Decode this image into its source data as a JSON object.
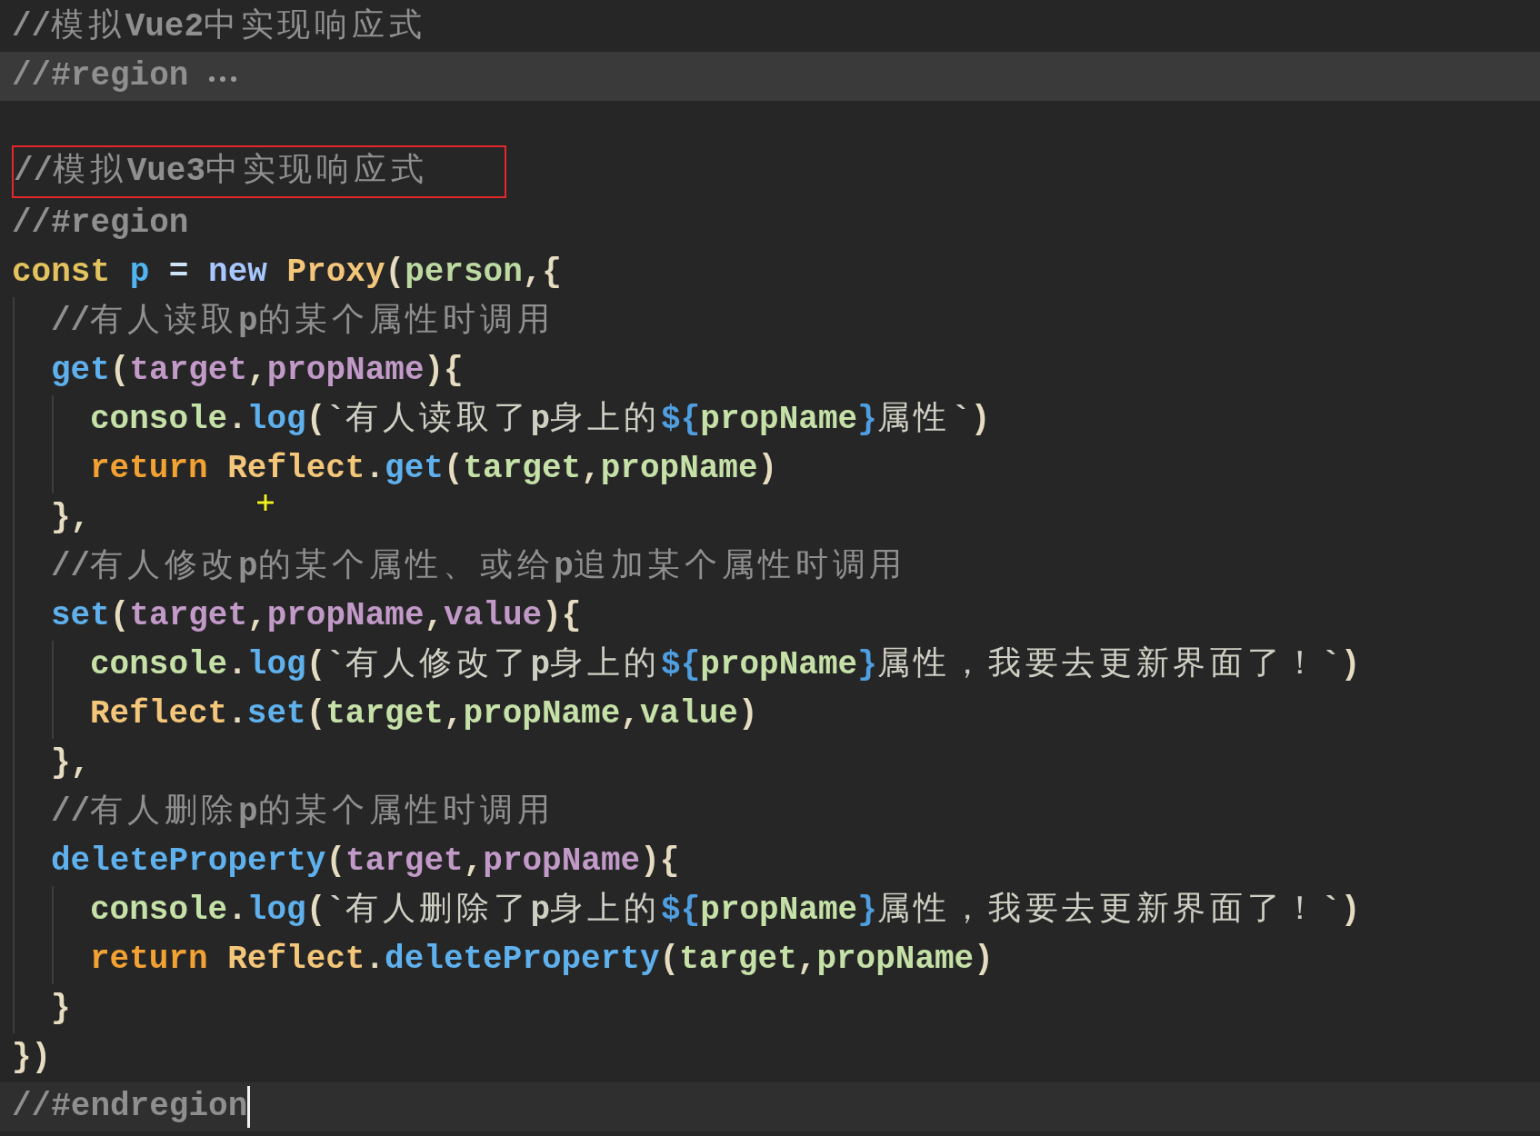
{
  "editor": {
    "lines": [
      {
        "folded": false,
        "active": false,
        "boxed": false,
        "tokens": [
          {
            "kind": "comment",
            "text": "//模拟Vue2中实现响应式"
          }
        ]
      },
      {
        "folded": true,
        "active": false,
        "boxed": false,
        "tokens": [
          {
            "kind": "comment",
            "text": "//#region"
          }
        ]
      },
      {
        "folded": false,
        "active": false,
        "boxed": false
      },
      {
        "folded": false,
        "active": false,
        "boxed": true,
        "tokens": [
          {
            "kind": "comment",
            "text": "//模拟Vue3中实现响应式"
          }
        ]
      },
      {
        "folded": false,
        "active": false,
        "boxed": false,
        "tokens": [
          {
            "kind": "comment",
            "text": "//#region"
          }
        ]
      },
      {
        "folded": false,
        "active": false,
        "boxed": false,
        "tokens": [
          {
            "kind": "storage",
            "text": "const "
          },
          {
            "kind": "variable",
            "text": "p "
          },
          {
            "kind": "operator",
            "text": "= "
          },
          {
            "kind": "new",
            "text": "new "
          },
          {
            "kind": "class",
            "text": "Proxy"
          },
          {
            "kind": "punctuation",
            "text": "("
          },
          {
            "kind": "argument",
            "text": "person"
          },
          {
            "kind": "punctuation",
            "text": ",{"
          }
        ],
        "children": [
          {
            "tokens": [
              {
                "kind": "comment",
                "text": "//有人读取p的某个属性时调用"
              }
            ]
          },
          {
            "tokens": [
              {
                "kind": "function",
                "text": "get"
              },
              {
                "kind": "punctuation",
                "text": "("
              },
              {
                "kind": "parameter",
                "text": "target"
              },
              {
                "kind": "punctuation",
                "text": ","
              },
              {
                "kind": "parameter",
                "text": "propName"
              },
              {
                "kind": "punctuation",
                "text": "){"
              }
            ],
            "children": [
              {
                "tokens": [
                  {
                    "kind": "object",
                    "text": "console"
                  },
                  {
                    "kind": "punctuation",
                    "text": "."
                  },
                  {
                    "kind": "function",
                    "text": "log"
                  },
                  {
                    "kind": "punctuation",
                    "text": "("
                  },
                  {
                    "kind": "string",
                    "text": "`有人读取了p身上的"
                  },
                  {
                    "kind": "interpolation",
                    "text": "${"
                  },
                  {
                    "kind": "object",
                    "text": "propName"
                  },
                  {
                    "kind": "interpolation",
                    "text": "}"
                  },
                  {
                    "kind": "string",
                    "text": "属性`"
                  },
                  {
                    "kind": "punctuation",
                    "text": ")"
                  }
                ]
              },
              {
                "tokens": [
                  {
                    "kind": "control",
                    "text": "return "
                  },
                  {
                    "kind": "class",
                    "text": "Reflect"
                  },
                  {
                    "kind": "punctuation",
                    "text": "."
                  },
                  {
                    "kind": "function",
                    "text": "get"
                  },
                  {
                    "kind": "punctuation",
                    "text": "("
                  },
                  {
                    "kind": "object",
                    "text": "target"
                  },
                  {
                    "kind": "punctuation",
                    "text": ","
                  },
                  {
                    "kind": "object",
                    "text": "propName"
                  },
                  {
                    "kind": "punctuation",
                    "text": ")"
                  }
                ]
              }
            ]
          },
          {
            "tokens": [
              {
                "kind": "punctuation",
                "text": "},"
              }
            ]
          },
          {
            "tokens": [
              {
                "kind": "comment",
                "text": "//有人修改p的某个属性、或给p追加某个属性时调用"
              }
            ]
          },
          {
            "tokens": [
              {
                "kind": "function",
                "text": "set"
              },
              {
                "kind": "punctuation",
                "text": "("
              },
              {
                "kind": "parameter",
                "text": "target"
              },
              {
                "kind": "punctuation",
                "text": ","
              },
              {
                "kind": "parameter",
                "text": "propName"
              },
              {
                "kind": "punctuation",
                "text": ","
              },
              {
                "kind": "parameter",
                "text": "value"
              },
              {
                "kind": "punctuation",
                "text": "){"
              }
            ],
            "children": [
              {
                "tokens": [
                  {
                    "kind": "object",
                    "text": "console"
                  },
                  {
                    "kind": "punctuation",
                    "text": "."
                  },
                  {
                    "kind": "function",
                    "text": "log"
                  },
                  {
                    "kind": "punctuation",
                    "text": "("
                  },
                  {
                    "kind": "string",
                    "text": "`有人修改了p身上的"
                  },
                  {
                    "kind": "interpolation",
                    "text": "${"
                  },
                  {
                    "kind": "object",
                    "text": "propName"
                  },
                  {
                    "kind": "interpolation",
                    "text": "}"
                  },
                  {
                    "kind": "string",
                    "text": "属性，我要去更新界面了！`"
                  },
                  {
                    "kind": "punctuation",
                    "text": ")"
                  }
                ]
              },
              {
                "tokens": [
                  {
                    "kind": "class",
                    "text": "Reflect"
                  },
                  {
                    "kind": "punctuation",
                    "text": "."
                  },
                  {
                    "kind": "function",
                    "text": "set"
                  },
                  {
                    "kind": "punctuation",
                    "text": "("
                  },
                  {
                    "kind": "object",
                    "text": "target"
                  },
                  {
                    "kind": "punctuation",
                    "text": ","
                  },
                  {
                    "kind": "object",
                    "text": "propName"
                  },
                  {
                    "kind": "punctuation",
                    "text": ","
                  },
                  {
                    "kind": "object",
                    "text": "value"
                  },
                  {
                    "kind": "punctuation",
                    "text": ")"
                  }
                ]
              }
            ]
          },
          {
            "tokens": [
              {
                "kind": "punctuation",
                "text": "},"
              }
            ]
          },
          {
            "tokens": [
              {
                "kind": "comment",
                "text": "//有人删除p的某个属性时调用"
              }
            ]
          },
          {
            "tokens": [
              {
                "kind": "function",
                "text": "deleteProperty"
              },
              {
                "kind": "punctuation",
                "text": "("
              },
              {
                "kind": "parameter",
                "text": "target"
              },
              {
                "kind": "punctuation",
                "text": ","
              },
              {
                "kind": "parameter",
                "text": "propName"
              },
              {
                "kind": "punctuation",
                "text": "){"
              }
            ],
            "children": [
              {
                "tokens": [
                  {
                    "kind": "object",
                    "text": "console"
                  },
                  {
                    "kind": "punctuation",
                    "text": "."
                  },
                  {
                    "kind": "function",
                    "text": "log"
                  },
                  {
                    "kind": "punctuation",
                    "text": "("
                  },
                  {
                    "kind": "string",
                    "text": "`有人删除了p身上的"
                  },
                  {
                    "kind": "interpolation",
                    "text": "${"
                  },
                  {
                    "kind": "object",
                    "text": "propName"
                  },
                  {
                    "kind": "interpolation",
                    "text": "}"
                  },
                  {
                    "kind": "string",
                    "text": "属性，我要去更新界面了！`"
                  },
                  {
                    "kind": "punctuation",
                    "text": ")"
                  }
                ]
              },
              {
                "tokens": [
                  {
                    "kind": "control",
                    "text": "return "
                  },
                  {
                    "kind": "class",
                    "text": "Reflect"
                  },
                  {
                    "kind": "punctuation",
                    "text": "."
                  },
                  {
                    "kind": "function",
                    "text": "deleteProperty"
                  },
                  {
                    "kind": "punctuation",
                    "text": "("
                  },
                  {
                    "kind": "object",
                    "text": "target"
                  },
                  {
                    "kind": "punctuation",
                    "text": ","
                  },
                  {
                    "kind": "object",
                    "text": "propName"
                  },
                  {
                    "kind": "punctuation",
                    "text": ")"
                  }
                ]
              }
            ]
          },
          {
            "tokens": [
              {
                "kind": "punctuation",
                "text": "}"
              }
            ]
          }
        ]
      },
      {
        "folded": false,
        "active": false,
        "boxed": false,
        "tokens": [
          {
            "kind": "punctuation",
            "text": "})"
          }
        ]
      },
      {
        "folded": false,
        "active": true,
        "boxed": false,
        "tokens": [
          {
            "kind": "comment",
            "text": "//#endregion"
          }
        ]
      }
    ]
  }
}
